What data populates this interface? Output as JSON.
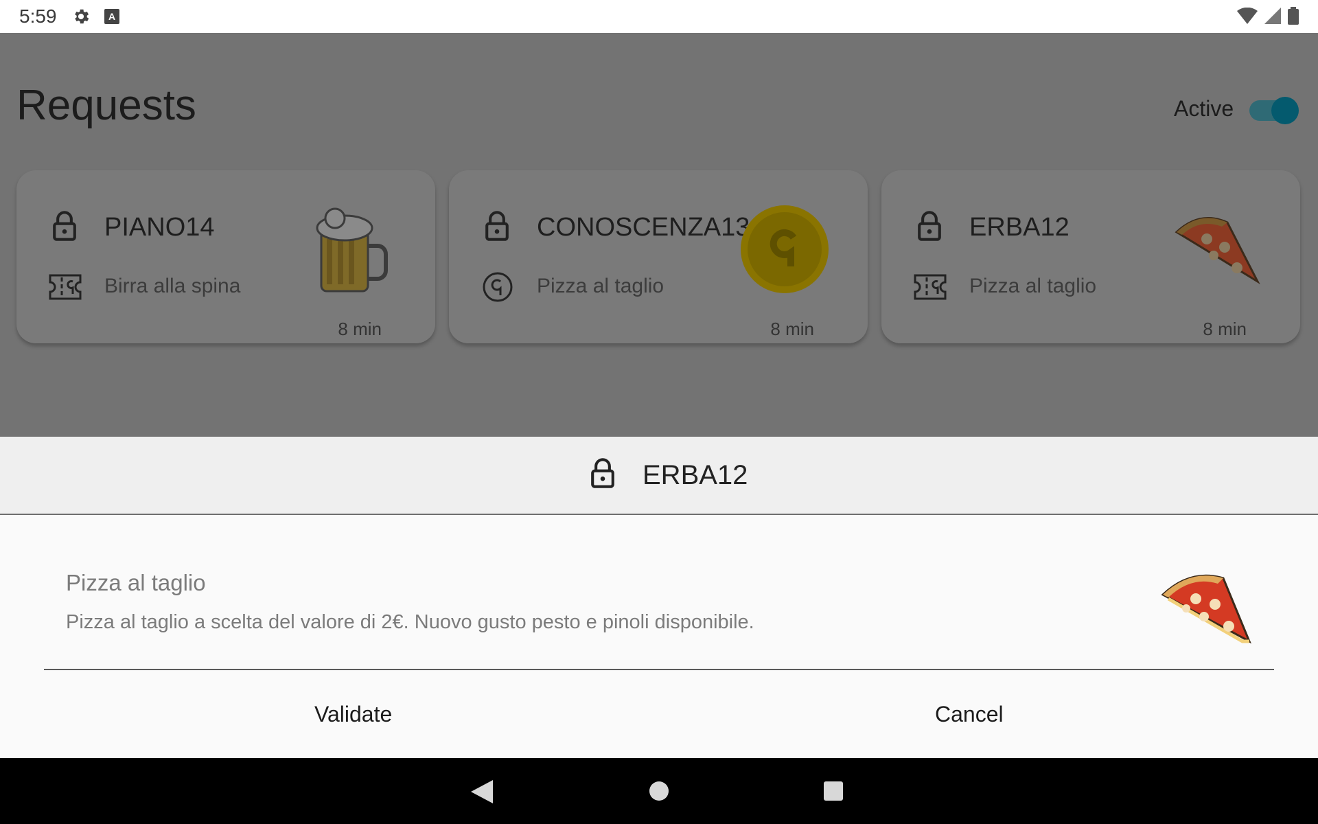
{
  "status_bar": {
    "time": "5:59",
    "icons": [
      "settings-icon",
      "a-icon",
      "wifi-icon",
      "signal-icon",
      "battery-icon"
    ],
    "a_icon_label": "A"
  },
  "header": {
    "title": "Requests",
    "active_label": "Active",
    "active_on": true
  },
  "cards": [
    {
      "code": "PIANO14",
      "type_icon": "ticket-icon",
      "description": "Birra alla spina",
      "time": "8 min",
      "image": "beer-mug"
    },
    {
      "code": "CONOSCENZA13",
      "type_icon": "coin-icon",
      "description": "Pizza al taglio",
      "time": "8 min",
      "image": "gold-coin"
    },
    {
      "code": "ERBA12",
      "type_icon": "ticket-icon",
      "description": "Pizza al taglio",
      "time": "8 min",
      "image": "pizza-slice"
    }
  ],
  "sheet": {
    "code": "ERBA12",
    "name": "Pizza al taglio",
    "detail": "Pizza al taglio a scelta del valore di 2€. Nuovo gusto pesto e pinoli disponibile.",
    "image": "pizza-slice",
    "validate_label": "Validate",
    "cancel_label": "Cancel"
  },
  "colors": {
    "overlay": "#737373",
    "accent": "#045a6e",
    "coin": "#b79a00"
  }
}
